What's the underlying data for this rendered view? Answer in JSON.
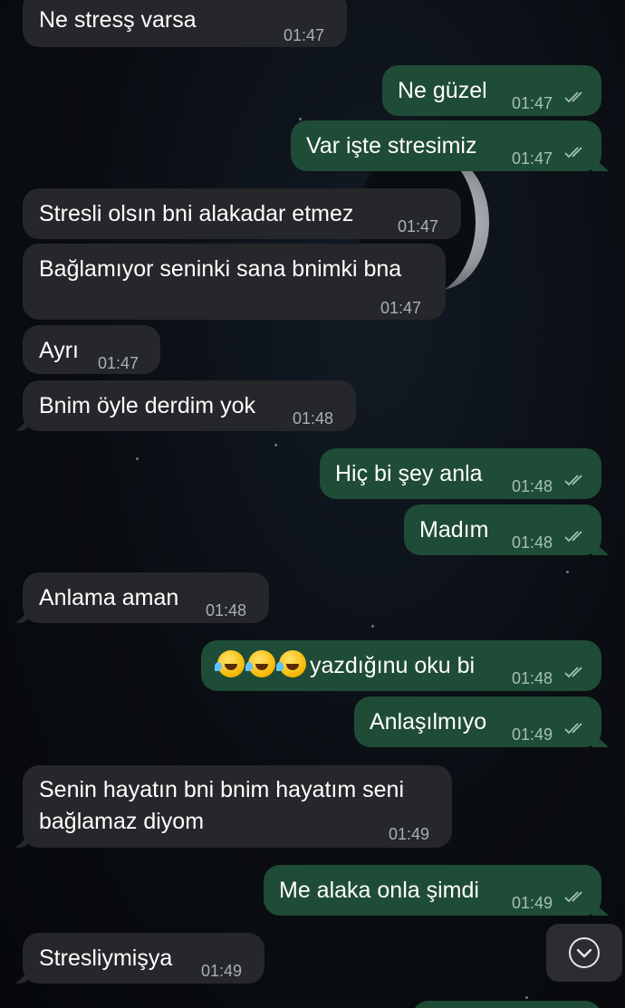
{
  "chat": {
    "messages": [
      {
        "dir": "in",
        "text": "Ne stresş varsa",
        "time": "01:47"
      },
      {
        "dir": "out",
        "text": "Ne güzel",
        "time": "01:47",
        "read": true
      },
      {
        "dir": "out",
        "text": "Var işte stresimiz",
        "time": "01:47",
        "read": true
      },
      {
        "dir": "in",
        "text": "Stresli olsın bni alakadar etmez",
        "time": "01:47"
      },
      {
        "dir": "in",
        "text": "Bağlamıyor seninki sana bnimki bna",
        "time": "01:47"
      },
      {
        "dir": "in",
        "text": "Ayrı",
        "time": "01:47"
      },
      {
        "dir": "in",
        "text": "Bnim öyle derdim yok",
        "time": "01:48"
      },
      {
        "dir": "out",
        "text": "Hiç bi şey anla",
        "time": "01:48",
        "read": true
      },
      {
        "dir": "out",
        "text": "Madım",
        "time": "01:48",
        "read": true
      },
      {
        "dir": "in",
        "text": "Anlama aman",
        "time": "01:48"
      },
      {
        "dir": "out",
        "text": "yazdığınu oku bi",
        "emoji": "rolling-on-the-floor-laughing x3",
        "time": "01:48",
        "read": true
      },
      {
        "dir": "out",
        "text": "Anlaşılmıyo",
        "time": "01:49",
        "read": true
      },
      {
        "dir": "in",
        "text_line1": "Senin hayatın bni bnim hayatım seni",
        "text_line2": "bağlamaz diyom",
        "time": "01:49"
      },
      {
        "dir": "out",
        "text": "Me alaka onla şimdi",
        "time": "01:49",
        "read": true
      },
      {
        "dir": "in",
        "text": "Stresliymişya",
        "time": "01:49"
      }
    ]
  },
  "icons": {
    "read_receipt": "double-check-icon",
    "scroll_down": "chevron-down-circle-icon"
  },
  "colors": {
    "incoming_bubble": "#25272a",
    "outgoing_bubble": "#1f4c36",
    "background": "#0a0d12"
  }
}
